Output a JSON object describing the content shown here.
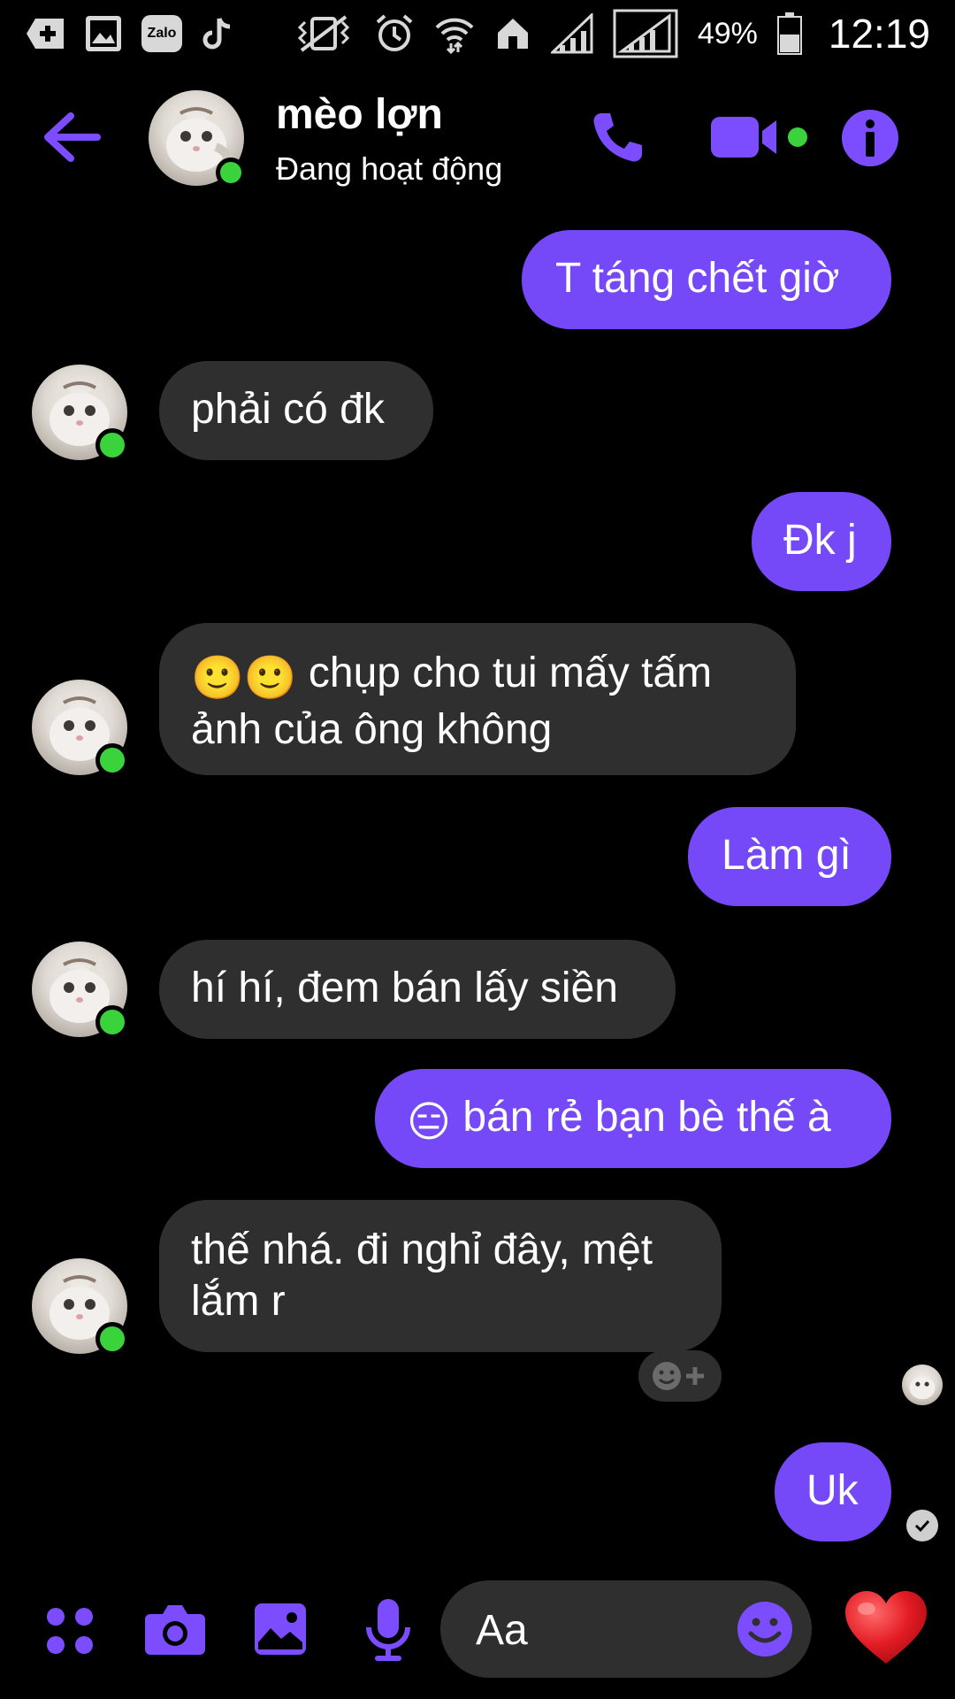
{
  "status_bar": {
    "zalo_label": "Zalo",
    "battery_percent": "49%",
    "time": "12:19"
  },
  "header": {
    "contact_name": "mèo lợn",
    "contact_status": "Đang hoạt động"
  },
  "messages": [
    {
      "sender": "me",
      "text": "T táng chết giờ"
    },
    {
      "sender": "them",
      "text": "phải có đk"
    },
    {
      "sender": "me",
      "text": "Đk j"
    },
    {
      "sender": "them",
      "emoji": "🙂🙂",
      "text": "chụp cho tui mấy tấm ảnh của ông không"
    },
    {
      "sender": "me",
      "text": "Làm gì"
    },
    {
      "sender": "them",
      "text": "hí hí, đem bán lấy siền"
    },
    {
      "sender": "me",
      "emoji": "😑",
      "text": "bán rẻ bạn bè thế à"
    },
    {
      "sender": "them",
      "text": "thế nhá. đi nghỉ đây, mệt lắm r"
    },
    {
      "sender": "me",
      "text": "Uk"
    }
  ],
  "composer": {
    "placeholder": "Aa",
    "like_emoji": "❤️"
  },
  "colors": {
    "accent": "#7649f8",
    "icon_purple": "#7c4dff",
    "incoming_bubble": "#2f2f2f",
    "online": "#3bd33b",
    "background": "#000000"
  },
  "icons": {
    "back": "arrow-left-icon",
    "call": "phone-icon",
    "video": "video-camera-icon",
    "info": "info-icon",
    "menu": "four-dots-icon",
    "camera": "camera-icon",
    "gallery": "image-icon",
    "mic": "microphone-icon",
    "emoji": "smiley-icon",
    "like": "heart-icon"
  }
}
